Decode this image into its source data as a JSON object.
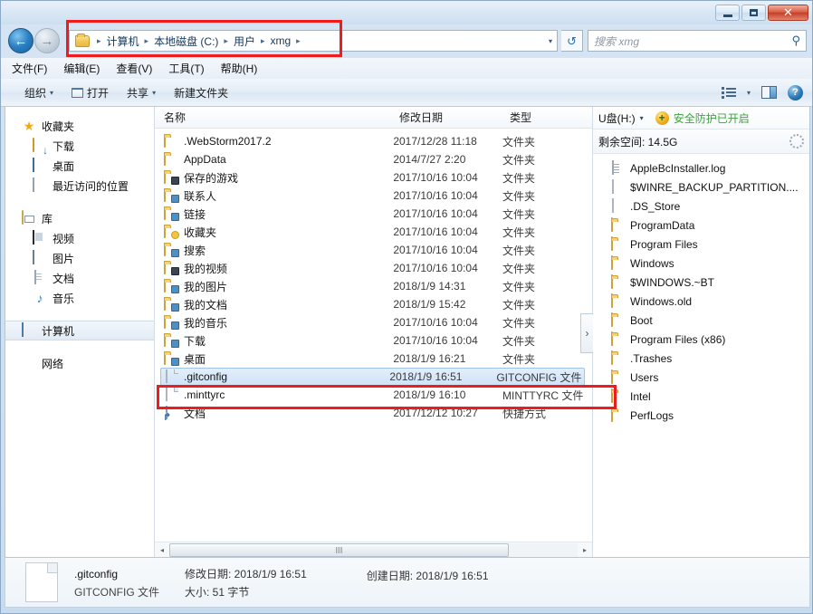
{
  "window": {
    "controls": {
      "minimize": "–",
      "maximize": "□",
      "close": "✕"
    }
  },
  "address": {
    "back_glyph": "←",
    "forward_glyph": "→",
    "crumbs": [
      "计算机",
      "本地磁盘 (C:)",
      "用户",
      "xmg"
    ],
    "separator": "▸",
    "dropdown_glyph": "▾",
    "refresh_glyph": "↺"
  },
  "search": {
    "placeholder": "搜索 xmg",
    "icon_glyph": "⚲"
  },
  "menubar": {
    "items": [
      "文件(F)",
      "编辑(E)",
      "查看(V)",
      "工具(T)",
      "帮助(H)"
    ]
  },
  "toolbar": {
    "organize": "组织",
    "open": "打开",
    "share": "共享",
    "new_folder": "新建文件夹",
    "caret": "▾",
    "help_glyph": "?"
  },
  "sidebar": {
    "groups": [
      {
        "header": {
          "label": "收藏夹",
          "icon": "star-icon"
        },
        "items": [
          {
            "label": "下载",
            "icon": "download-folder-icon"
          },
          {
            "label": "桌面",
            "icon": "desktop-icon"
          },
          {
            "label": "最近访问的位置",
            "icon": "recent-places-icon"
          }
        ]
      },
      {
        "header": {
          "label": "库",
          "icon": "library-icon"
        },
        "items": [
          {
            "label": "视频",
            "icon": "video-icon"
          },
          {
            "label": "图片",
            "icon": "picture-icon"
          },
          {
            "label": "文档",
            "icon": "document-icon"
          },
          {
            "label": "音乐",
            "icon": "music-icon"
          }
        ]
      }
    ],
    "computer": {
      "label": "计算机",
      "icon": "computer-icon",
      "selected": true
    },
    "network": {
      "label": "网络",
      "icon": "network-icon"
    }
  },
  "filelist": {
    "columns": {
      "name": "名称",
      "date": "修改日期",
      "type": "类型"
    },
    "rows": [
      {
        "name": ".WebStorm2017.2",
        "date": "2017/12/28 11:18",
        "type": "文件夹",
        "icon": "folder-icon",
        "selected": false
      },
      {
        "name": "AppData",
        "date": "2014/7/27 2:20",
        "type": "文件夹",
        "icon": "folder-icon",
        "selected": false
      },
      {
        "name": "保存的游戏",
        "date": "2017/10/16 10:04",
        "type": "文件夹",
        "icon": "folder-dark-badge-icon",
        "selected": false
      },
      {
        "name": "联系人",
        "date": "2017/10/16 10:04",
        "type": "文件夹",
        "icon": "folder-contacts-icon",
        "selected": false
      },
      {
        "name": "链接",
        "date": "2017/10/16 10:04",
        "type": "文件夹",
        "icon": "folder-links-icon",
        "selected": false
      },
      {
        "name": "收藏夹",
        "date": "2017/10/16 10:04",
        "type": "文件夹",
        "icon": "folder-star-icon",
        "selected": false
      },
      {
        "name": "搜索",
        "date": "2017/10/16 10:04",
        "type": "文件夹",
        "icon": "folder-search-icon",
        "selected": false
      },
      {
        "name": "我的视频",
        "date": "2017/10/16 10:04",
        "type": "文件夹",
        "icon": "folder-video-icon",
        "selected": false
      },
      {
        "name": "我的图片",
        "date": "2018/1/9 14:31",
        "type": "文件夹",
        "icon": "folder-picture-icon",
        "selected": false
      },
      {
        "name": "我的文档",
        "date": "2018/1/9 15:42",
        "type": "文件夹",
        "icon": "folder-document-icon",
        "selected": false
      },
      {
        "name": "我的音乐",
        "date": "2017/10/16 10:04",
        "type": "文件夹",
        "icon": "folder-music-icon",
        "selected": false
      },
      {
        "name": "下载",
        "date": "2017/10/16 10:04",
        "type": "文件夹",
        "icon": "folder-download-icon",
        "selected": false
      },
      {
        "name": "桌面",
        "date": "2018/1/9 16:21",
        "type": "文件夹",
        "icon": "folder-desktop-icon",
        "selected": false
      },
      {
        "name": ".gitconfig",
        "date": "2018/1/9 16:51",
        "type": "GITCONFIG 文件",
        "icon": "file-icon",
        "selected": true
      },
      {
        "name": ".minttyrc",
        "date": "2018/1/9 16:10",
        "type": "MINTTYRC 文件",
        "icon": "file-icon",
        "selected": false
      },
      {
        "name": "文档",
        "date": "2017/12/12 10:27",
        "type": "快捷方式",
        "icon": "shortcut-icon",
        "selected": false
      }
    ]
  },
  "usb": {
    "title": "U盘(H:)",
    "caret": "▾",
    "shield_glyph": "+",
    "safe_text": "安全防护已开启",
    "free_space": "剩余空间: 14.5G",
    "collapse_glyph": "›",
    "items": [
      {
        "name": "AppleBcInstaller.log",
        "icon": "log-file-icon"
      },
      {
        "name": "$WINRE_BACKUP_PARTITION....",
        "icon": "file-icon"
      },
      {
        "name": ".DS_Store",
        "icon": "file-icon"
      },
      {
        "name": "ProgramData",
        "icon": "folder-icon"
      },
      {
        "name": "Program Files",
        "icon": "folder-icon"
      },
      {
        "name": "Windows",
        "icon": "folder-icon"
      },
      {
        "name": "$WINDOWS.~BT",
        "icon": "folder-icon"
      },
      {
        "name": "Windows.old",
        "icon": "folder-icon"
      },
      {
        "name": "Boot",
        "icon": "folder-icon"
      },
      {
        "name": "Program Files (x86)",
        "icon": "folder-icon"
      },
      {
        "name": ".Trashes",
        "icon": "folder-icon"
      },
      {
        "name": "Users",
        "icon": "folder-icon"
      },
      {
        "name": "Intel",
        "icon": "folder-icon"
      },
      {
        "name": "PerfLogs",
        "icon": "folder-icon"
      }
    ]
  },
  "details": {
    "file_name": ".gitconfig",
    "file_type": "GITCONFIG 文件",
    "modified": "修改日期: 2018/1/9 16:51",
    "size": "大小: 51 字节",
    "created": "创建日期: 2018/1/9 16:51"
  },
  "scrollbar": {
    "left_arrow": "◂",
    "right_arrow": "▸"
  },
  "colors": {
    "annotation": "#ee1c1c",
    "selection": "#cfe3f7",
    "safe_green": "#3aa33a"
  }
}
